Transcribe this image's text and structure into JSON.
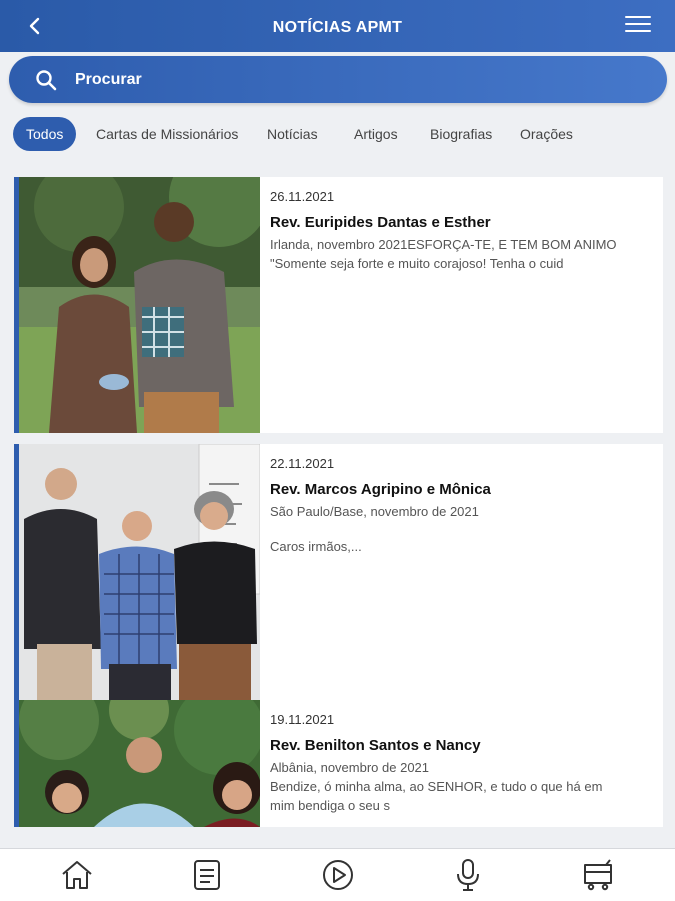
{
  "header": {
    "title": "NOTÍCIAS APMT"
  },
  "search": {
    "label": "Procurar"
  },
  "tabs": [
    {
      "label": "Todos"
    },
    {
      "label": "Cartas de Missionários"
    },
    {
      "label": "Notícias"
    },
    {
      "label": "Artigos"
    },
    {
      "label": "Biografias"
    },
    {
      "label": "Orações"
    }
  ],
  "articles": [
    {
      "date": "26.11.2021",
      "title": "Rev. Euripides Dantas e Esther",
      "line1": "Irlanda, novembro 2021ESFORÇA-TE, E TEM BOM ANIMO",
      "line2": "\"Somente seja forte e muito corajoso! Tenha o cuid"
    },
    {
      "date": "22.11.2021",
      "title": "Rev. Marcos Agripino e Mônica",
      "line1": "São Paulo/Base, novembro de 2021",
      "line2": "Caros irmãos,..."
    },
    {
      "date": "19.11.2021",
      "title": "Rev. Benilton Santos e Nancy",
      "line1": "Albânia, novembro de 2021",
      "line2": "Bendize, ó minha alma, ao SENHOR, e tudo o que há em",
      "line3": "mim bendiga o seu s"
    }
  ],
  "colors": {
    "primary": "#2e5dae",
    "background": "#eef0f3"
  },
  "bottom_nav": [
    "home-icon",
    "news-icon",
    "play-icon",
    "microphone-icon",
    "cart-icon"
  ]
}
